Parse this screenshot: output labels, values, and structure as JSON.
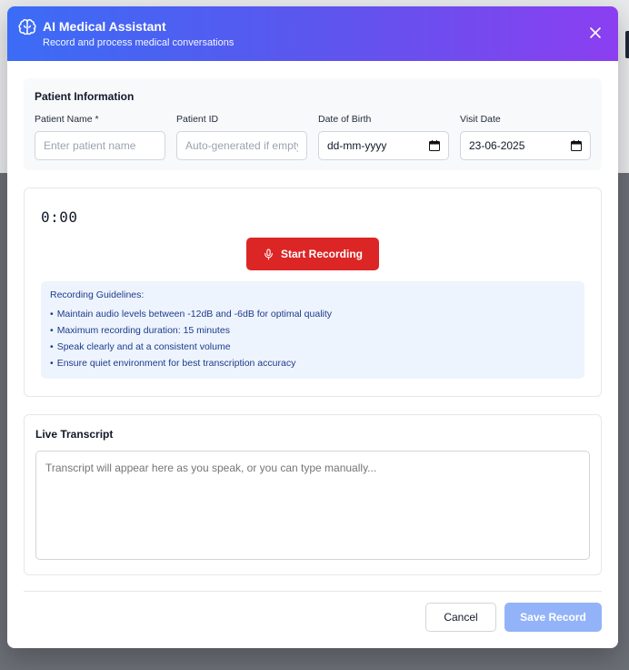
{
  "header": {
    "title": "AI Medical Assistant",
    "subtitle": "Record and process medical conversations",
    "icon": "brain-icon"
  },
  "patient_info": {
    "title": "Patient Information",
    "fields": [
      {
        "label": "Patient Name *",
        "value": "",
        "placeholder": "Enter patient name"
      },
      {
        "label": "Patient ID",
        "value": "",
        "placeholder": "Auto-generated if empty"
      },
      {
        "label": "Date of Birth",
        "value": "dd-mm-yyyy",
        "placeholder": ""
      },
      {
        "label": "Visit Date",
        "value": "23-06-2025",
        "placeholder": ""
      }
    ]
  },
  "recording": {
    "timer": "0:00",
    "button_label": "Start Recording",
    "button_color": "#dc2626",
    "guidelines_title": "Recording Guidelines:",
    "guidelines": [
      "Maintain audio levels between -12dB and -6dB for optimal quality",
      "Maximum recording duration: 15 minutes",
      "Speak clearly and at a consistent volume",
      "Ensure quiet environment for best transcription accuracy"
    ]
  },
  "transcript": {
    "title": "Live Transcript",
    "placeholder": "Transcript will appear here as you speak, or you can type manually..."
  },
  "footer": {
    "cancel_label": "Cancel",
    "save_label": "Save Record"
  },
  "colors": {
    "header_gradient_start": "#3b6cf6",
    "header_gradient_end": "#8b3ff0",
    "guidelines_bg": "#eef4fe",
    "save_button_disabled": "#93b3f8"
  }
}
